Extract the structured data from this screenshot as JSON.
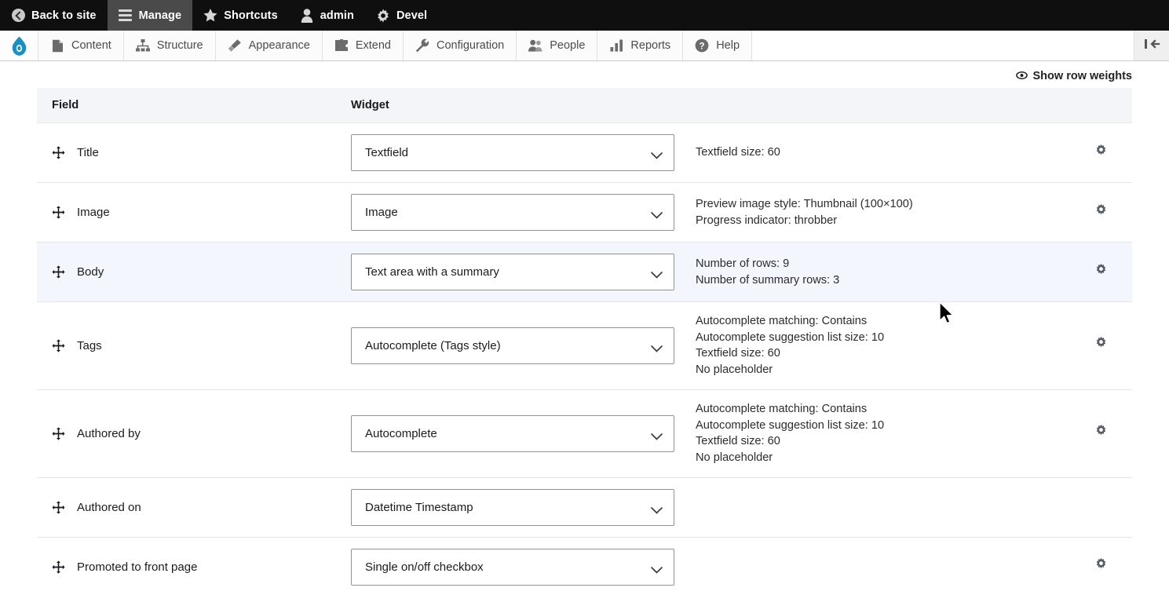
{
  "toolbar": {
    "items": [
      {
        "label": "Back to site",
        "icon": "back-arrow-icon",
        "active": false
      },
      {
        "label": "Manage",
        "icon": "hamburger-icon",
        "active": true
      },
      {
        "label": "Shortcuts",
        "icon": "star-icon",
        "active": false
      },
      {
        "label": "admin",
        "icon": "user-icon",
        "active": false
      },
      {
        "label": "Devel",
        "icon": "gear-icon",
        "active": false
      }
    ]
  },
  "admin_menu": {
    "logo": "drupal-droplet-icon",
    "items": [
      {
        "label": "Content",
        "icon": "document-icon"
      },
      {
        "label": "Structure",
        "icon": "sitemap-icon"
      },
      {
        "label": "Appearance",
        "icon": "paintbrush-icon"
      },
      {
        "label": "Extend",
        "icon": "puzzle-piece-icon"
      },
      {
        "label": "Configuration",
        "icon": "wrench-icon"
      },
      {
        "label": "People",
        "icon": "people-icon"
      },
      {
        "label": "Reports",
        "icon": "bar-chart-icon"
      },
      {
        "label": "Help",
        "icon": "question-mark-icon"
      }
    ],
    "collapse_icon": "collapse-sidebar-icon"
  },
  "row_weights": {
    "label": "Show row weights",
    "icon": "eye-icon"
  },
  "table": {
    "headers": {
      "field": "Field",
      "widget": "Widget"
    },
    "rows": [
      {
        "field": "Title",
        "widget": "Textfield",
        "summary": [
          "Textfield size: 60"
        ],
        "has_settings": true,
        "highlighted": false
      },
      {
        "field": "Image",
        "widget": "Image",
        "summary": [
          "Preview image style: Thumbnail (100×100)",
          "Progress indicator: throbber"
        ],
        "has_settings": true,
        "highlighted": false
      },
      {
        "field": "Body",
        "widget": "Text area with a summary",
        "summary": [
          "Number of rows: 9",
          "Number of summary rows: 3"
        ],
        "has_settings": true,
        "highlighted": true
      },
      {
        "field": "Tags",
        "widget": "Autocomplete (Tags style)",
        "summary": [
          "Autocomplete matching: Contains",
          "Autocomplete suggestion list size: 10",
          "Textfield size: 60",
          "No placeholder"
        ],
        "has_settings": true,
        "highlighted": false
      },
      {
        "field": "Authored by",
        "widget": "Autocomplete",
        "summary": [
          "Autocomplete matching: Contains",
          "Autocomplete suggestion list size: 10",
          "Textfield size: 60",
          "No placeholder"
        ],
        "has_settings": true,
        "highlighted": false
      },
      {
        "field": "Authored on",
        "widget": "Datetime Timestamp",
        "summary": [],
        "has_settings": false,
        "highlighted": false
      },
      {
        "field": "Promoted to front page",
        "widget": "Single on/off checkbox",
        "summary": [],
        "has_settings": true,
        "highlighted": false
      }
    ]
  },
  "colors": {
    "toolbar_bg": "#0f0f0f",
    "toolbar_active": "#4a4a4a",
    "drupal_blue": "#1a8fc1",
    "header_bg": "#f3f5f8",
    "row_highlight": "#f3f6fc",
    "border": "#e2e4e8"
  }
}
